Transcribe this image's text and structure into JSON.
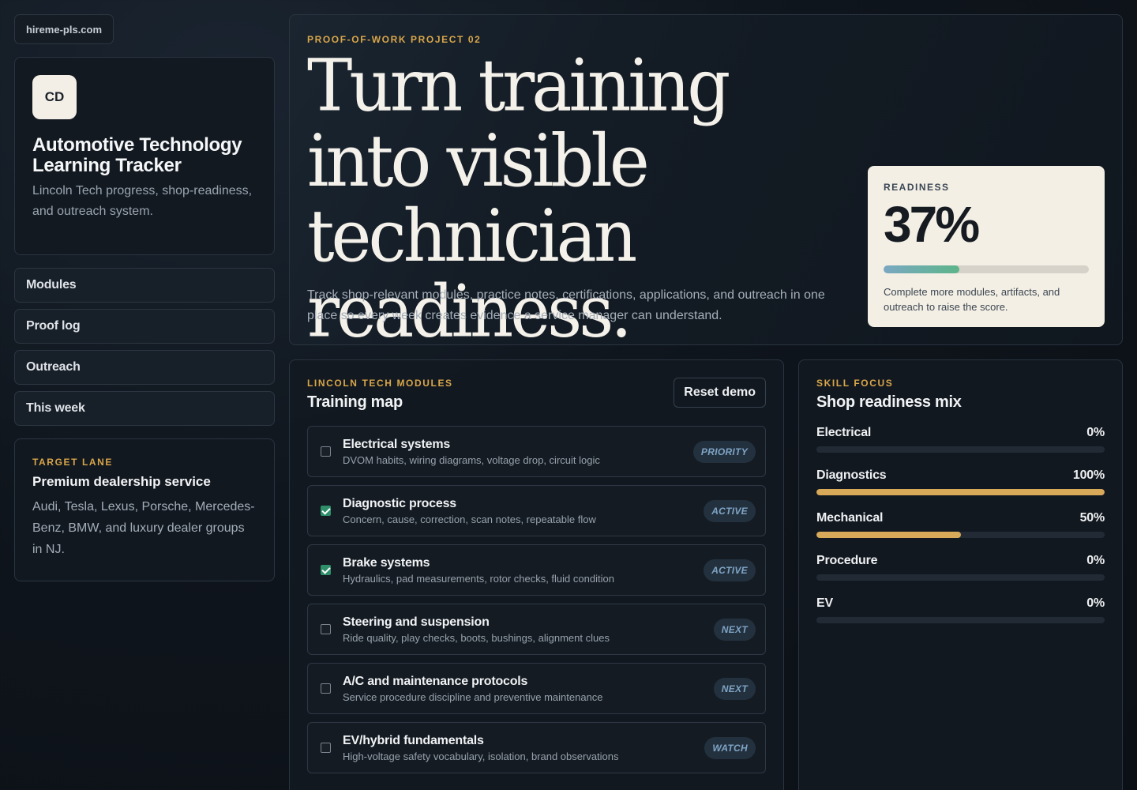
{
  "site": {
    "domain": "hireme-pls.com"
  },
  "brand": {
    "initials": "CD",
    "title": "Automotive Technology Learning Tracker",
    "subtitle": "Lincoln Tech progress, shop-readiness, and outreach system."
  },
  "nav": [
    "Modules",
    "Proof log",
    "Outreach",
    "This week"
  ],
  "target_lane": {
    "eyebrow": "TARGET LANE",
    "title": "Premium dealership service",
    "text": "Audi, Tesla, Lexus, Porsche, Mercedes-Benz, BMW, and luxury dealer groups in NJ."
  },
  "hero": {
    "eyebrow": "PROOF-OF-WORK PROJECT 02",
    "headline": "Turn training into visible technician readiness.",
    "description": "Track shop-relevant modules, practice notes, certifications, applications, and outreach in one place so every week creates evidence a service manager can understand."
  },
  "readiness": {
    "label": "READINESS",
    "value": "37%",
    "fraction": 0.37,
    "note": "Complete more modules, artifacts, and outreach to raise the score."
  },
  "modules": {
    "eyebrow": "LINCOLN TECH MODULES",
    "title": "Training map",
    "reset_label": "Reset demo",
    "items": [
      {
        "name": "Electrical systems",
        "desc": "DVOM habits, wiring diagrams, voltage drop, circuit logic",
        "status": "PRIORITY",
        "checked": false
      },
      {
        "name": "Diagnostic process",
        "desc": "Concern, cause, correction, scan notes, repeatable flow",
        "status": "ACTIVE",
        "checked": true
      },
      {
        "name": "Brake systems",
        "desc": "Hydraulics, pad measurements, rotor checks, fluid condition",
        "status": "ACTIVE",
        "checked": true
      },
      {
        "name": "Steering and suspension",
        "desc": "Ride quality, play checks, boots, bushings, alignment clues",
        "status": "NEXT",
        "checked": false
      },
      {
        "name": "A/C and maintenance protocols",
        "desc": "Service procedure discipline and preventive maintenance",
        "status": "NEXT",
        "checked": false
      },
      {
        "name": "EV/hybrid fundamentals",
        "desc": "High-voltage safety vocabulary, isolation, brand observations",
        "status": "WATCH",
        "checked": false
      }
    ]
  },
  "skills": {
    "eyebrow": "SKILL FOCUS",
    "title": "Shop readiness mix",
    "items": [
      {
        "name": "Electrical",
        "pct": "0%",
        "fraction": 0
      },
      {
        "name": "Diagnostics",
        "pct": "100%",
        "fraction": 1
      },
      {
        "name": "Mechanical",
        "pct": "50%",
        "fraction": 0.5
      },
      {
        "name": "Procedure",
        "pct": "0%",
        "fraction": 0
      },
      {
        "name": "EV",
        "pct": "0%",
        "fraction": 0
      }
    ]
  },
  "colors": {
    "accent": "#d9a64a",
    "bar_fill": "#d9a95a",
    "check": "#2f8f6a",
    "card": "#f3efe5"
  }
}
